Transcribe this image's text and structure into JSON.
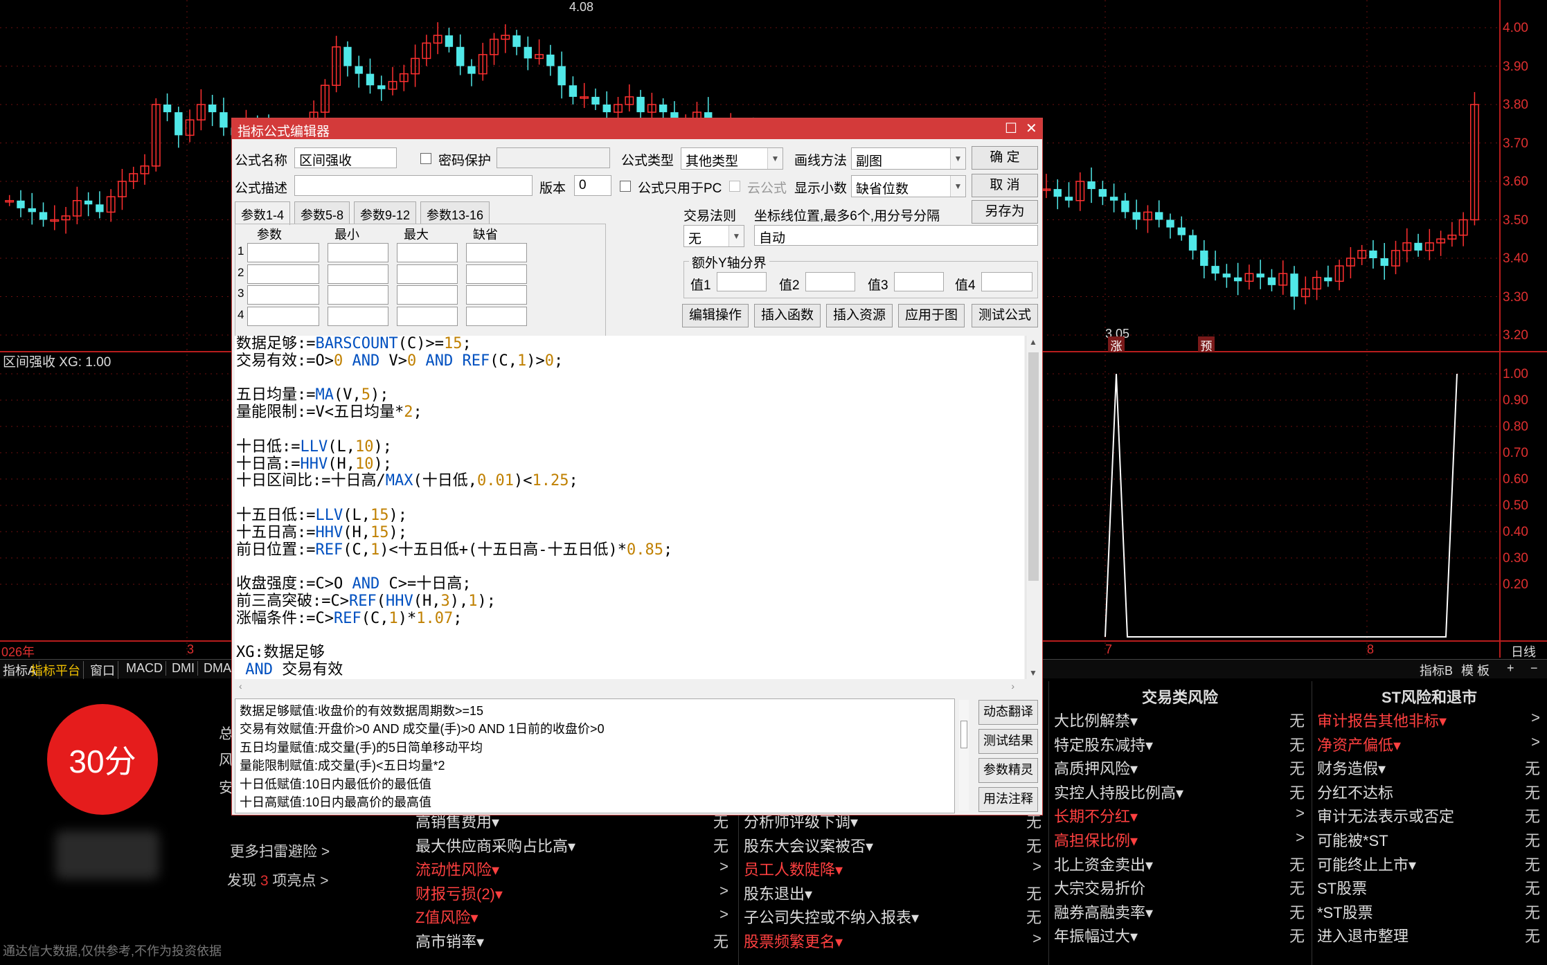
{
  "chart": {
    "price_axis": [
      "4.00",
      "3.90",
      "3.80",
      "3.70",
      "3.60",
      "3.50",
      "3.40",
      "3.30",
      "3.20"
    ],
    "indicator_axis": [
      "1.00",
      "0.90",
      "0.80",
      "0.70",
      "0.60",
      "0.50",
      "0.40",
      "0.30",
      "0.20"
    ],
    "high_label": "4.08",
    "low_label": "3.05",
    "marker_zhang": "涨",
    "marker_yu": "预",
    "indicator_label": "区间强收  XG: 1.00",
    "dates": {
      "d0": "026年",
      "d1": "3",
      "d2": "7",
      "d3": "8",
      "d4": "日线"
    },
    "up_color": "#ff3030",
    "down_color": "#50e8e8",
    "indicator_color": "#ffffff"
  },
  "tabbar": {
    "tabs": [
      "指标A",
      "指标平台",
      "窗口",
      "MACD",
      "DMI",
      "DMA"
    ],
    "right": {
      "indicator_b": "指标B",
      "template": "模 板",
      "plus": "+",
      "minus": "−"
    }
  },
  "score": {
    "value": "30分"
  },
  "left_panel": {
    "chars": [
      "总",
      "风",
      "安"
    ],
    "more_link": "更多扫雷避险 >",
    "discover_pre": "发现",
    "discover_count": "3",
    "discover_post": "项亮点 >",
    "footnote": "通达信大数据,仅供参考,不作为投资依据"
  },
  "risk_columns": [
    {
      "header": "",
      "rows": [
        {
          "name": "高销售费用▾",
          "value": "无",
          "red": false
        },
        {
          "name": "最大供应商采购占比高▾",
          "value": "无",
          "red": false
        },
        {
          "name": "流动性风险▾",
          "value": ">",
          "red": true
        },
        {
          "name": "财报亏损(2)▾",
          "value": ">",
          "red": true
        },
        {
          "name": "Z值风险▾",
          "value": ">",
          "red": true
        },
        {
          "name": "高市销率▾",
          "value": "无",
          "red": false
        }
      ]
    },
    {
      "header": "",
      "rows": [
        {
          "name": "分析师评级下调▾",
          "value": "无",
          "red": false
        },
        {
          "name": "股东大会议案被否▾",
          "value": "无",
          "red": false
        },
        {
          "name": "员工人数陡降▾",
          "value": ">",
          "red": true
        },
        {
          "name": "股东退出▾",
          "value": "无",
          "red": false
        },
        {
          "name": "子公司失控或不纳入报表▾",
          "value": "无",
          "red": false
        },
        {
          "name": "股票频繁更名▾",
          "value": ">",
          "red": true
        }
      ]
    },
    {
      "header": "交易类风险",
      "rows": [
        {
          "name": "大比例解禁▾",
          "value": "无",
          "red": false
        },
        {
          "name": "特定股东减持▾",
          "value": "无",
          "red": false
        },
        {
          "name": "高质押风险▾",
          "value": "无",
          "red": false
        },
        {
          "name": "实控人持股比例高▾",
          "value": "无",
          "red": false
        },
        {
          "name": "长期不分红▾",
          "value": ">",
          "red": true
        },
        {
          "name": "高担保比例▾",
          "value": ">",
          "red": true
        },
        {
          "name": "北上资金卖出▾",
          "value": "无",
          "red": false
        },
        {
          "name": "大宗交易折价",
          "value": "无",
          "red": false
        },
        {
          "name": "融券高融卖率▾",
          "value": "无",
          "red": false
        },
        {
          "name": "年振幅过大▾",
          "value": "无",
          "red": false
        }
      ]
    },
    {
      "header": "ST风险和退市",
      "rows": [
        {
          "name": "审计报告其他非标▾",
          "value": ">",
          "red": true
        },
        {
          "name": "净资产偏低▾",
          "value": ">",
          "red": true
        },
        {
          "name": "财务造假▾",
          "value": "无",
          "red": false
        },
        {
          "name": "分红不达标",
          "value": "无",
          "red": false
        },
        {
          "name": "审计无法表示或否定",
          "value": "无",
          "red": false
        },
        {
          "name": "可能被*ST",
          "value": "无",
          "red": false
        },
        {
          "name": "可能终止上市▾",
          "value": "无",
          "red": false
        },
        {
          "name": "ST股票",
          "value": "无",
          "red": false
        },
        {
          "name": "*ST股票",
          "value": "无",
          "red": false
        },
        {
          "name": "进入退市整理",
          "value": "无",
          "red": false
        }
      ]
    }
  ],
  "dialog": {
    "title": "指标公式编辑器",
    "formula_name_label": "公式名称",
    "formula_name_value": "区间强收",
    "password_label": "密码保护",
    "formula_type_label": "公式类型",
    "formula_type_value": "其他类型",
    "draw_method_label": "画线方法",
    "draw_method_value": "副图",
    "ok": "确  定",
    "cancel": "取  消",
    "save_as": "另存为",
    "desc_label": "公式描述",
    "version_label": "版本",
    "version_value": "0",
    "pc_only_label": "公式只用于PC",
    "cloud_label": "云公式",
    "decimals_label": "显示小数",
    "decimals_value": "缺省位数",
    "param_tabs": [
      "参数1-4",
      "参数5-8",
      "参数9-12",
      "参数13-16"
    ],
    "param_headers": [
      "参数",
      "最小",
      "最大",
      "缺省"
    ],
    "param_rows": [
      "1",
      "2",
      "3",
      "4"
    ],
    "trade_rule_label": "交易法则",
    "trade_rule_value": "无",
    "coord_label": "坐标线位置,最多6个,用分号分隔",
    "coord_value": "自动",
    "y_axis_group": "额外Y轴分界",
    "y_vals": [
      "值1",
      "值2",
      "值3",
      "值4"
    ],
    "action_buttons": [
      "编辑操作",
      "插入函数",
      "插入资源",
      "应用于图",
      "测试公式"
    ],
    "side_buttons": [
      "动态翻译",
      "测试结果",
      "参数精灵",
      "用法注释"
    ],
    "code_lines": [
      [
        [
          "t",
          "数据足够:="
        ],
        [
          "k",
          "BARSCOUNT"
        ],
        [
          "t",
          "(C)>="
        ],
        [
          "n",
          "15"
        ],
        [
          "t",
          ";"
        ]
      ],
      [
        [
          "t",
          "交易有效:=O>"
        ],
        [
          "n",
          "0"
        ],
        [
          "k",
          " AND "
        ],
        [
          "t",
          "V>"
        ],
        [
          "n",
          "0"
        ],
        [
          "k",
          " AND "
        ],
        [
          "k",
          "REF"
        ],
        [
          "t",
          "(C,"
        ],
        [
          "n",
          "1"
        ],
        [
          "t",
          ")>"
        ],
        [
          "n",
          "0"
        ],
        [
          "t",
          ";"
        ]
      ],
      [],
      [
        [
          "t",
          "五日均量:="
        ],
        [
          "k",
          "MA"
        ],
        [
          "t",
          "(V,"
        ],
        [
          "n",
          "5"
        ],
        [
          "t",
          ");"
        ]
      ],
      [
        [
          "t",
          "量能限制:=V<五日均量*"
        ],
        [
          "n",
          "2"
        ],
        [
          "t",
          ";"
        ]
      ],
      [],
      [
        [
          "t",
          "十日低:="
        ],
        [
          "k",
          "LLV"
        ],
        [
          "t",
          "(L,"
        ],
        [
          "n",
          "10"
        ],
        [
          "t",
          ");"
        ]
      ],
      [
        [
          "t",
          "十日高:="
        ],
        [
          "k",
          "HHV"
        ],
        [
          "t",
          "(H,"
        ],
        [
          "n",
          "10"
        ],
        [
          "t",
          ");"
        ]
      ],
      [
        [
          "t",
          "十日区间比:=十日高/"
        ],
        [
          "k",
          "MAX"
        ],
        [
          "t",
          "(十日低,"
        ],
        [
          "n",
          "0.01"
        ],
        [
          "t",
          ")<"
        ],
        [
          "n",
          "1.25"
        ],
        [
          "t",
          ";"
        ]
      ],
      [],
      [
        [
          "t",
          "十五日低:="
        ],
        [
          "k",
          "LLV"
        ],
        [
          "t",
          "(L,"
        ],
        [
          "n",
          "15"
        ],
        [
          "t",
          ");"
        ]
      ],
      [
        [
          "t",
          "十五日高:="
        ],
        [
          "k",
          "HHV"
        ],
        [
          "t",
          "(H,"
        ],
        [
          "n",
          "15"
        ],
        [
          "t",
          ");"
        ]
      ],
      [
        [
          "t",
          "前日位置:="
        ],
        [
          "k",
          "REF"
        ],
        [
          "t",
          "(C,"
        ],
        [
          "n",
          "1"
        ],
        [
          "t",
          ")<十五日低+(十五日高-十五日低)*"
        ],
        [
          "n",
          "0.85"
        ],
        [
          "t",
          ";"
        ]
      ],
      [],
      [
        [
          "t",
          "收盘强度:=C>O"
        ],
        [
          "k",
          " AND "
        ],
        [
          "t",
          "C>=十日高;"
        ]
      ],
      [
        [
          "t",
          "前三高突破:=C>"
        ],
        [
          "k",
          "REF"
        ],
        [
          "t",
          "("
        ],
        [
          "k",
          "HHV"
        ],
        [
          "t",
          "(H,"
        ],
        [
          "n",
          "3"
        ],
        [
          "t",
          "),"
        ],
        [
          "n",
          "1"
        ],
        [
          "t",
          ");"
        ]
      ],
      [
        [
          "t",
          "涨幅条件:=C>"
        ],
        [
          "k",
          "REF"
        ],
        [
          "t",
          "(C,"
        ],
        [
          "n",
          "1"
        ],
        [
          "t",
          ")*"
        ],
        [
          "n",
          "1.07"
        ],
        [
          "t",
          ";"
        ]
      ],
      [],
      [
        [
          "t",
          "XG:数据足够"
        ]
      ],
      [
        [
          "k",
          " AND "
        ],
        [
          "t",
          "交易有效"
        ]
      ]
    ],
    "desc_lines": [
      "数据足够赋值:收盘价的有效数据周期数>=15",
      "交易有效赋值:开盘价>0 AND 成交量(手)>0 AND 1日前的收盘价>0",
      "五日均量赋值:成交量(手)的5日简单移动平均",
      "量能限制赋值:成交量(手)<五日均量*2",
      "十日低赋值:10日内最低价的最低值",
      "十日高赋值:10日内最高价的最高值"
    ]
  }
}
